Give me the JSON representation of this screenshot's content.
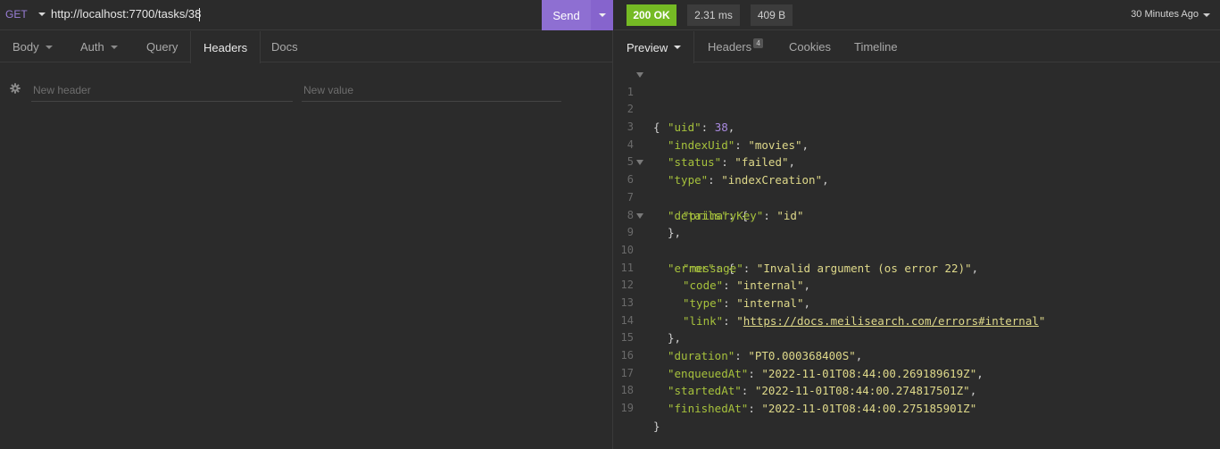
{
  "request": {
    "method": "GET",
    "url": "http://localhost:7700/tasks/38",
    "send_label": "Send",
    "tabs": [
      {
        "label": "Body"
      },
      {
        "label": "Auth"
      },
      {
        "label": "Query"
      },
      {
        "label": "Headers"
      },
      {
        "label": "Docs"
      }
    ],
    "active_tab": "Headers",
    "header_name_placeholder": "New header",
    "header_value_placeholder": "New value"
  },
  "response": {
    "status": "200 OK",
    "time": "2.31 ms",
    "size": "409 B",
    "history_label": "30 Minutes Ago",
    "tabs": [
      {
        "label": "Preview"
      },
      {
        "label": "Headers",
        "badge": "4"
      },
      {
        "label": "Cookies"
      },
      {
        "label": "Timeline"
      }
    ],
    "active_tab": "Preview",
    "body_lines": [
      {
        "n": "1",
        "t": "{"
      },
      {
        "n": "2",
        "t": "\"uid\": 38,"
      },
      {
        "n": "3",
        "t": "\"indexUid\": \"movies\","
      },
      {
        "n": "4",
        "t": "\"status\": \"failed\","
      },
      {
        "n": "5",
        "t": "\"type\": \"indexCreation\","
      },
      {
        "n": "6",
        "t": "\"details\": {"
      },
      {
        "n": "7",
        "t": "\"primaryKey\": \"id\""
      },
      {
        "n": "8",
        "t": "},"
      },
      {
        "n": "9",
        "t": "\"error\": {"
      },
      {
        "n": "10",
        "t": "\"message\": \"Invalid argument (os error 22)\","
      },
      {
        "n": "11",
        "t": "\"code\": \"internal\","
      },
      {
        "n": "12",
        "t": "\"type\": \"internal\","
      },
      {
        "n": "13",
        "t": "\"link\": \"https://docs.meilisearch.com/errors#internal\""
      },
      {
        "n": "14",
        "t": "},"
      },
      {
        "n": "15",
        "t": "\"duration\": \"PT0.000368400S\","
      },
      {
        "n": "16",
        "t": "\"enqueuedAt\": \"2022-11-01T08:44:00.269189619Z\","
      },
      {
        "n": "17",
        "t": "\"startedAt\": \"2022-11-01T08:44:00.274817501Z\","
      },
      {
        "n": "18",
        "t": "\"finishedAt\": \"2022-11-01T08:44:00.275185901Z\""
      },
      {
        "n": "19",
        "t": "}"
      }
    ],
    "body": {
      "uid": "38",
      "indexUid": "movies",
      "status": "failed",
      "type": "indexCreation",
      "details_primaryKey": "id",
      "error_message": "Invalid argument (os error 22)",
      "error_code": "internal",
      "error_type": "internal",
      "error_link": "https://docs.meilisearch.com/errors#internal",
      "duration": "PT0.000368400S",
      "enqueuedAt": "2022-11-01T08:44:00.269189619Z",
      "startedAt": "2022-11-01T08:44:00.274817501Z",
      "finishedAt": "2022-11-01T08:44:00.275185901Z"
    }
  },
  "icons": {
    "gear": "gear-icon",
    "caret": "chevron-down-icon"
  },
  "colors": {
    "send": "#8e6fd2",
    "status_ok": "#75ba24",
    "method": "#9a7fd8",
    "json_key": "#a6c13c",
    "json_string": "#dfd98a",
    "json_number": "#a98ae0"
  }
}
